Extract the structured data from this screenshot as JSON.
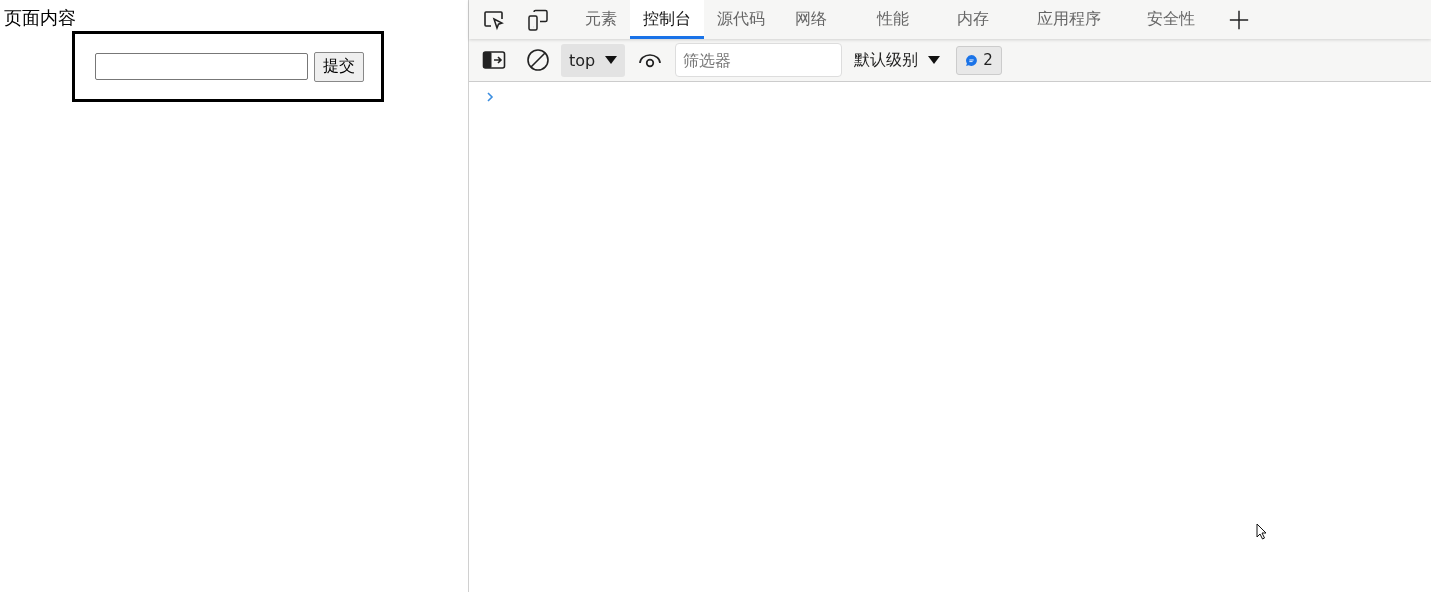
{
  "page": {
    "heading": "页面内容",
    "submit_button": "提交"
  },
  "devtools": {
    "tabs": [
      {
        "label": "元素",
        "selected": false
      },
      {
        "label": "控制台",
        "selected": true
      },
      {
        "label": "源代码",
        "selected": false
      },
      {
        "label": "网络",
        "selected": false
      },
      {
        "label": "性能",
        "selected": false
      },
      {
        "label": "内存",
        "selected": false
      },
      {
        "label": "应用程序",
        "selected": false
      },
      {
        "label": "安全性",
        "selected": false
      }
    ],
    "toolbar": {
      "context": "top",
      "filter_placeholder": "筛选器",
      "log_level": "默认级别",
      "message_count": "2"
    }
  }
}
